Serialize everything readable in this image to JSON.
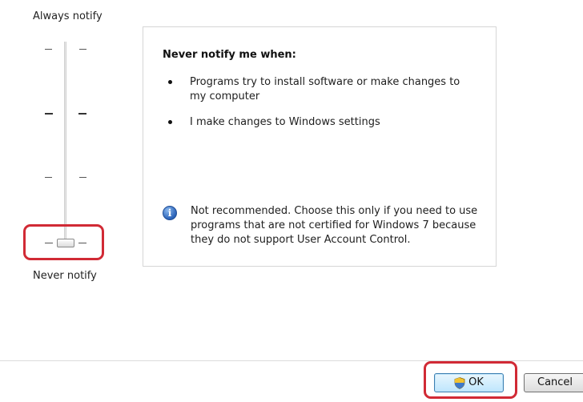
{
  "slider": {
    "top_label": "Always notify",
    "bottom_label": "Never notify",
    "levels": 4,
    "selected_level": 4
  },
  "panel": {
    "title": "Never notify me when:",
    "bullets": [
      "Programs try to install software or make changes to my computer",
      "I make changes to Windows settings"
    ],
    "info_icon": "info-icon",
    "info_text": "Not recommended. Choose this only if you need to use programs that are not certified for Windows 7 because they do not support User Account Control."
  },
  "buttons": {
    "ok_label": "OK",
    "ok_icon": "shield-icon",
    "cancel_label": "Cancel"
  },
  "colors": {
    "highlight": "#d12a35",
    "ok_button_accent": "#3c7fb1"
  }
}
